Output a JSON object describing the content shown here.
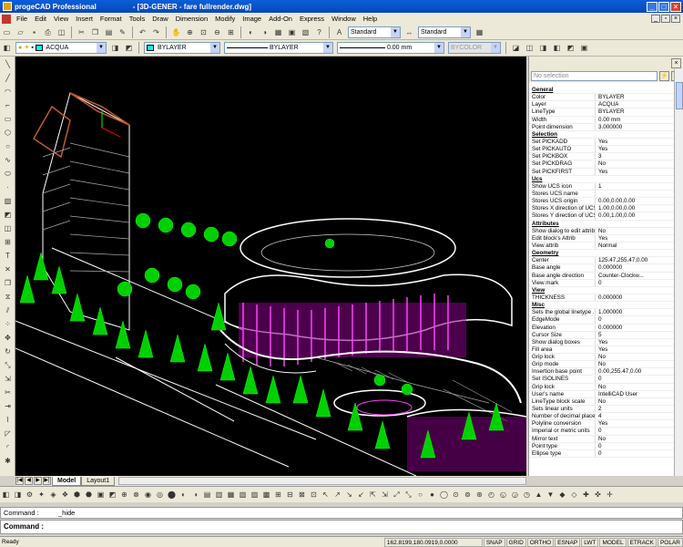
{
  "window": {
    "app_name": "progeCAD Professional",
    "doc_title": "- [3D-GENER - fare fullrender.dwg]"
  },
  "menu": [
    "File",
    "Edit",
    "View",
    "Insert",
    "Format",
    "Tools",
    "Draw",
    "Dimension",
    "Modify",
    "Image",
    "Add-On",
    "Express",
    "Window",
    "Help"
  ],
  "toolbar": {
    "text_style": "Standard",
    "dim_style": "Standard",
    "layer": "ACQUA",
    "color": "BYLAYER",
    "linetype": "BYLAYER",
    "lineweight": "0.00 mm",
    "plotstyle": "BYCOLOR"
  },
  "properties": {
    "selection": "No selection",
    "rows": [
      {
        "k": "General",
        "cat": true
      },
      {
        "k": "Color",
        "v": "BYLAYER"
      },
      {
        "k": "Layer",
        "v": "ACQUA"
      },
      {
        "k": "LineType",
        "v": "BYLAYER"
      },
      {
        "k": "Width",
        "v": "0.00 mm"
      },
      {
        "k": "Point dimension",
        "v": "3.000000"
      },
      {
        "k": "Selection",
        "cat": true
      },
      {
        "k": "Set PICKADD",
        "v": "Yes"
      },
      {
        "k": "Set PICKAUTO",
        "v": "Yes"
      },
      {
        "k": "Set PICKBOX",
        "v": "3"
      },
      {
        "k": "Set PICKDRAG",
        "v": "No"
      },
      {
        "k": "Set PICKFIRST",
        "v": "Yes"
      },
      {
        "k": "Ucs",
        "cat": true
      },
      {
        "k": "Show UCS icon",
        "v": "1"
      },
      {
        "k": "Stores UCS name",
        "v": ""
      },
      {
        "k": "Stores UCS origin",
        "v": "0.00,0.00,0.00"
      },
      {
        "k": "Stores X direction of UCS",
        "v": "1.00,0.00,0.00"
      },
      {
        "k": "Stores Y direction of UCS",
        "v": "0.00,1.00,0.00"
      },
      {
        "k": "Attributes",
        "cat": true
      },
      {
        "k": "Show dialog to edit attrib",
        "v": "No"
      },
      {
        "k": "Edit block's Attrib",
        "v": "Yes"
      },
      {
        "k": "View attrib",
        "v": "Normal"
      },
      {
        "k": "Geometry",
        "cat": true
      },
      {
        "k": "Center",
        "v": "125.47,255.47,0.00"
      },
      {
        "k": "Base angle",
        "v": "0.000000"
      },
      {
        "k": "Base angle direction",
        "v": "Counter-Clockw..."
      },
      {
        "k": "View mark",
        "v": "0"
      },
      {
        "k": "View",
        "cat": true
      },
      {
        "k": "THICKNESS",
        "v": "0.000000"
      },
      {
        "k": "Misc",
        "cat": true
      },
      {
        "k": "Sets the global linetype ...",
        "v": "1.000000"
      },
      {
        "k": "EdgeMode",
        "v": "0"
      },
      {
        "k": "Elevation",
        "v": "0.000000"
      },
      {
        "k": "Cursor Size",
        "v": "5"
      },
      {
        "k": "Show dialog boxes",
        "v": "Yes"
      },
      {
        "k": "Fill area",
        "v": "Yes"
      },
      {
        "k": "Grip lock",
        "v": "No"
      },
      {
        "k": "Grip mode",
        "v": "No"
      },
      {
        "k": "Insertion base point",
        "v": "0.00,255.47,0.00"
      },
      {
        "k": "Set ISOLINES",
        "v": "0"
      },
      {
        "k": "Grip lock",
        "v": "No"
      },
      {
        "k": "User's name",
        "v": "IntelliCAD User"
      },
      {
        "k": "LineType block scale",
        "v": "No"
      },
      {
        "k": "Sets linear units",
        "v": "2"
      },
      {
        "k": "Number of decimal places",
        "v": "4"
      },
      {
        "k": "Polyline conversion",
        "v": "Yes"
      },
      {
        "k": "Imperial or metric units",
        "v": "0"
      },
      {
        "k": "Mirror text",
        "v": "No"
      },
      {
        "k": "Point type",
        "v": "0"
      },
      {
        "k": "Ellipse type",
        "v": "0"
      }
    ]
  },
  "tabs": [
    "Model",
    "Layout1"
  ],
  "command": {
    "history_label": "Command :",
    "history_value": "_hide",
    "prompt": "Command :"
  },
  "status": {
    "ready": "Ready",
    "coords": "162.8199,180.0919,0.0000",
    "buttons": [
      "SNAP",
      "GRID",
      "ORTHO",
      "ESNAP",
      "LWT",
      "MODEL",
      "ETRACK",
      "POLAR"
    ]
  }
}
